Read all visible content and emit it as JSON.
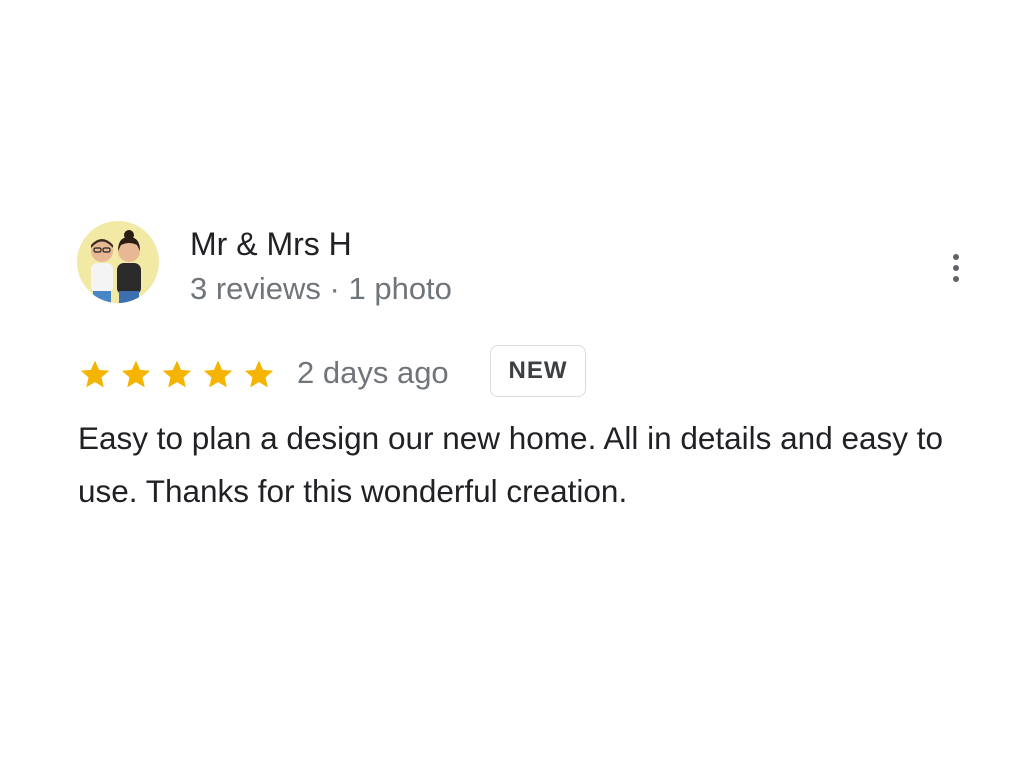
{
  "review": {
    "author_name": "Mr & Mrs H",
    "author_meta": "3 reviews · 1 photo",
    "rating": 5,
    "rating_max": 5,
    "date": "2 days ago",
    "badge": "NEW",
    "text": "Easy to plan a design our new home. All in details and easy to use. Thanks for this wonderful creation."
  },
  "icons": {
    "avatar": "avatar-couple",
    "more": "more-vert-icon",
    "star": "star-icon"
  },
  "colors": {
    "star": "#f4b400",
    "secondary_text": "#70757a",
    "primary_text": "#202124",
    "avatar_bg": "#f1e9a4"
  }
}
